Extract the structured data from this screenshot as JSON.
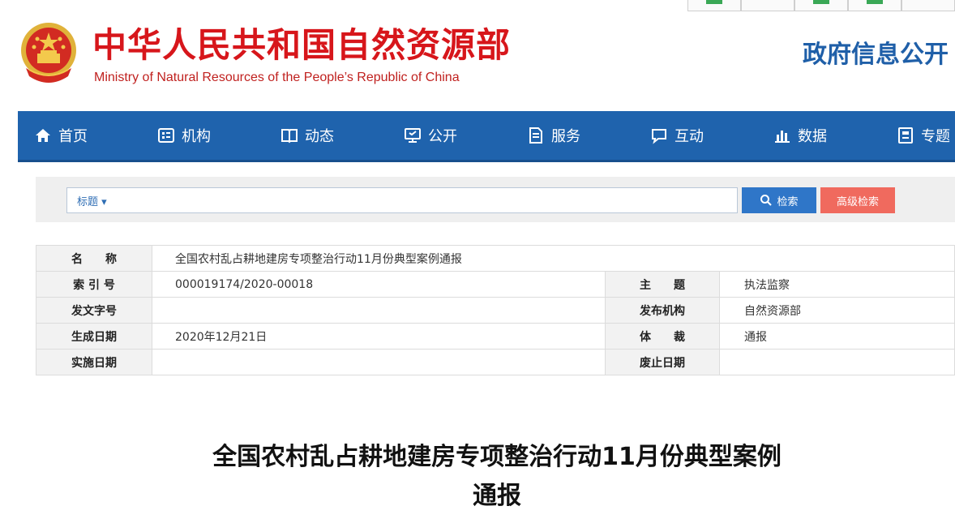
{
  "header": {
    "site_name_cn": "中华人民共和国自然资源部",
    "site_name_en": "Ministry of Natural Resources of the People’s Republic of China",
    "section_title": "政府信息公开"
  },
  "nav": {
    "items": [
      {
        "label": "首页",
        "icon": "home-icon"
      },
      {
        "label": "机构",
        "icon": "org-icon"
      },
      {
        "label": "动态",
        "icon": "book-icon"
      },
      {
        "label": "公开",
        "icon": "screen-icon"
      },
      {
        "label": "服务",
        "icon": "document-icon"
      },
      {
        "label": "互动",
        "icon": "chat-icon"
      },
      {
        "label": "数据",
        "icon": "bar-chart-icon"
      },
      {
        "label": "专题",
        "icon": "topic-icon"
      }
    ]
  },
  "search": {
    "field_label": "标题 ▾",
    "placeholder": "",
    "search_label": "检索",
    "advanced_label": "高级检索"
  },
  "info": {
    "name_label": "名　　称",
    "name_value": "全国农村乱占耕地建房专项整治行动11月份典型案例通报",
    "index_label": "索 引 号",
    "index_value": "000019174/2020-00018",
    "topic_label": "主　　题",
    "topic_value": "执法监察",
    "doc_no_label": "发文字号",
    "doc_no_value": "",
    "publisher_label": "发布机构",
    "publisher_value": "自然资源部",
    "date_label": "生成日期",
    "date_value": "2020年12月21日",
    "genre_label": "体　　裁",
    "genre_value": "通报",
    "effective_label": "实施日期",
    "effective_value": "",
    "expiry_label": "废止日期",
    "expiry_value": ""
  },
  "article": {
    "title_line1": "全国农村乱占耕地建房专项整治行动11月份典型案例",
    "title_line2": "通报"
  },
  "colors": {
    "brand_red": "#d7161b",
    "nav_blue": "#1f63ad",
    "search_blue": "#2f76c8",
    "advanced_red": "#f06a5e",
    "title_blue": "#1f5fa8"
  }
}
